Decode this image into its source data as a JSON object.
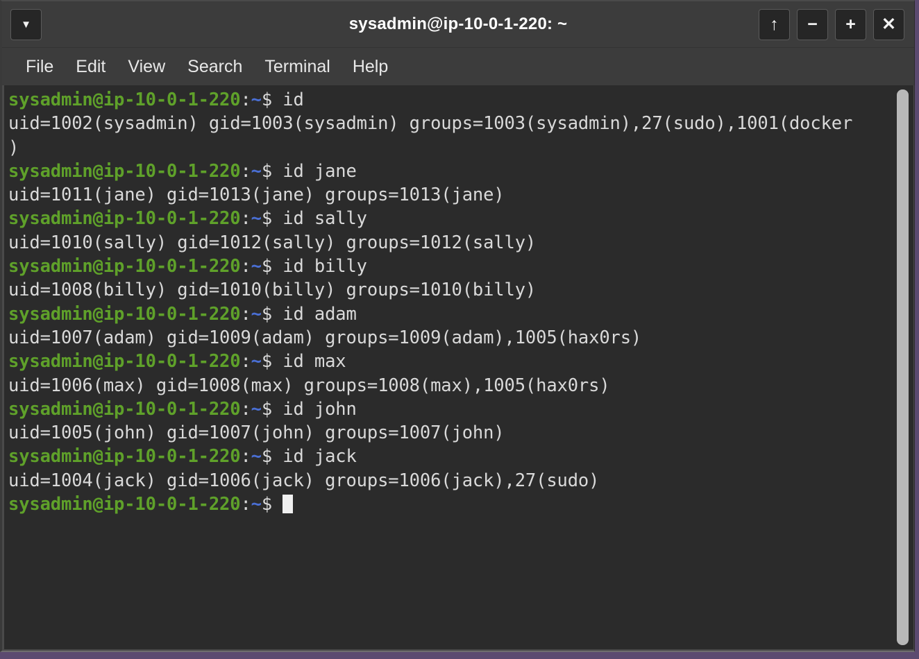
{
  "window": {
    "title": "sysadmin@ip-10-0-1-220: ~",
    "titlebar_buttons": [
      {
        "name": "window-menu-button",
        "glyph": "▼"
      },
      {
        "name": "shade-button",
        "glyph": "↑"
      },
      {
        "name": "minimize-button",
        "glyph": "−"
      },
      {
        "name": "maximize-button",
        "glyph": "+"
      },
      {
        "name": "close-button",
        "glyph": "✕"
      }
    ],
    "colors": {
      "frame": "#3c3c3c",
      "terminal_background": "#2b2b2b",
      "foreground": "#d9d9d9",
      "prompt_green": "#5fa12a",
      "prompt_blue": "#4a6fd4",
      "desktop": "#5b4a70",
      "scrollbar_thumb": "#b8b8b8"
    }
  },
  "menubar": {
    "items": [
      "File",
      "Edit",
      "View",
      "Search",
      "Terminal",
      "Help"
    ]
  },
  "terminal": {
    "prompt": {
      "user_host": "sysadmin@ip-10-0-1-220",
      "colon": ":",
      "path": "~",
      "dollar": "$"
    },
    "lines": [
      {
        "type": "prompt",
        "command": " id"
      },
      {
        "type": "output",
        "text": "uid=1002(sysadmin) gid=1003(sysadmin) groups=1003(sysadmin),27(sudo),1001(docker"
      },
      {
        "type": "output",
        "text": ")"
      },
      {
        "type": "prompt",
        "command": " id jane"
      },
      {
        "type": "output",
        "text": "uid=1011(jane) gid=1013(jane) groups=1013(jane)"
      },
      {
        "type": "prompt",
        "command": " id sally"
      },
      {
        "type": "output",
        "text": "uid=1010(sally) gid=1012(sally) groups=1012(sally)"
      },
      {
        "type": "prompt",
        "command": " id billy"
      },
      {
        "type": "output",
        "text": "uid=1008(billy) gid=1010(billy) groups=1010(billy)"
      },
      {
        "type": "prompt",
        "command": " id adam"
      },
      {
        "type": "output",
        "text": "uid=1007(adam) gid=1009(adam) groups=1009(adam),1005(hax0rs)"
      },
      {
        "type": "prompt",
        "command": " id max"
      },
      {
        "type": "output",
        "text": "uid=1006(max) gid=1008(max) groups=1008(max),1005(hax0rs)"
      },
      {
        "type": "prompt",
        "command": " id john"
      },
      {
        "type": "output",
        "text": "uid=1005(john) gid=1007(john) groups=1007(john)"
      },
      {
        "type": "prompt",
        "command": " id jack"
      },
      {
        "type": "output",
        "text": "uid=1004(jack) gid=1006(jack) groups=1006(jack),27(sudo)"
      },
      {
        "type": "prompt-cursor",
        "command": " "
      }
    ]
  }
}
